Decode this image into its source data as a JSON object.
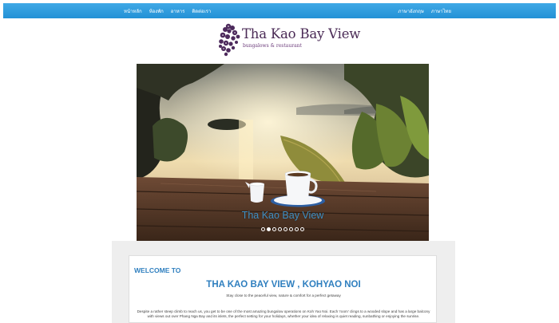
{
  "nav": {
    "left_links": [
      "หน้าหลัก",
      "ห้องพัก",
      "อาหาร",
      "ติดต่อเรา"
    ],
    "right_links": [
      "ภาษาอังกฤษ",
      "ภาษาไทย"
    ]
  },
  "logo": {
    "title": "Tha Kao Bay View",
    "subtitle": "bungalows & restaurant"
  },
  "carousel": {
    "caption": "Tha Kao Bay View",
    "slide_count": 8,
    "active_index": 1
  },
  "welcome": {
    "label": "WELCOME TO",
    "heading": "THA KAO BAY VIEW , KOHYAO NOI",
    "tagline": "Stay close to the peaceful view, nature & comfort for a perfect getaway",
    "intro": "Despite a rather steep climb to reach us, you get to be one of the most amazing bungalow operations on Koh Yao Noi. Each 'room' clings to a wooded slope and has a large balcony with views out over Phang Nga Bay and its islets, the perfect setting for your holidays, whether your idea of relaxing is quiet reading, sunbathing or enjoying the sunrise."
  },
  "colors": {
    "nav_bar": "#2a9ae0",
    "accent_blue": "#2f7fbf",
    "logo_purple": "#4a2a55"
  }
}
